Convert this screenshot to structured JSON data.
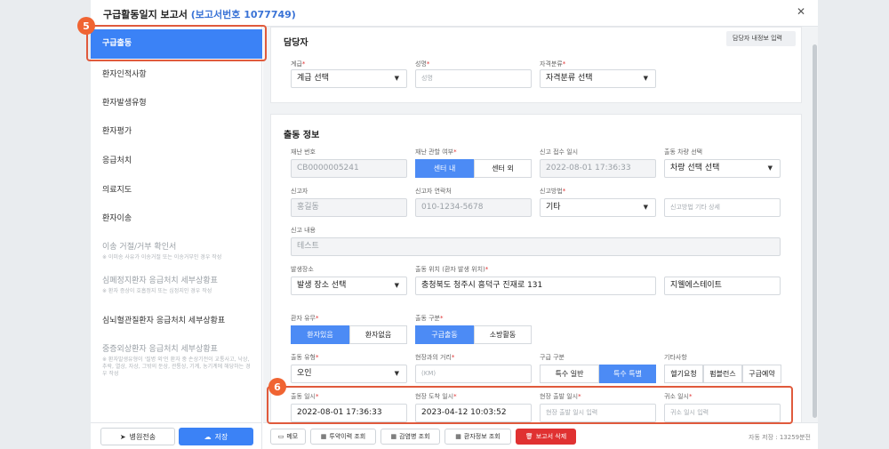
{
  "modal": {
    "title": "구급활동일지 보고서",
    "subtitle": "(보고서번호 1077749)"
  },
  "sidebar": {
    "items": [
      {
        "label": "구급출동"
      },
      {
        "label": "환자인적사항"
      },
      {
        "label": "환자발생유형"
      },
      {
        "label": "환자평가"
      },
      {
        "label": "응급처치"
      },
      {
        "label": "의료지도"
      },
      {
        "label": "환자이송"
      },
      {
        "label": "이송 거절/거부 확인서",
        "note": "※ 이미송 사유가 이송거절 또는 이송거부인 경우 작성"
      },
      {
        "label": "심폐정지환자 응급처치 세부상황표",
        "note": "※ 환자 증상이 호흡정지 또는 심정지인 경우 작성"
      },
      {
        "label": "심뇌혈관질환자 응급처치 세부상황표"
      },
      {
        "label": "중증외상환자 응급처치 세부상황표",
        "note": "※ 환자발생유형이 '질병 외'인 환자 중 손상기전이 교통사고, 낙상, 추락, 열상, 자상, 그밖의 둔상, 관통상, 기계, 농기계에 해당하는 경우 작성"
      }
    ],
    "footer": {
      "transfer": "병원전송",
      "save": "저장"
    }
  },
  "manager": {
    "title": "담당자",
    "self_button": "담당자 내정보 입력",
    "rank_label": "계급",
    "rank_value": "계급 선택",
    "name_label": "성명",
    "name_placeholder": "성명",
    "qual_label": "자격분류",
    "qual_value": "자격분류 선택"
  },
  "dispatch": {
    "title": "출동 정보",
    "disaster_no_label": "재난 번호",
    "disaster_no": "CB0000005241",
    "jurisdiction_label": "재난 관할 여부",
    "jur_in": "센터 내",
    "jur_out": "센터 외",
    "report_time_label": "신고 접수 일시",
    "report_time": "2022-08-01 17:36:33",
    "vehicle_label": "출동 차량 선택",
    "vehicle_value": "차량 선택 선택",
    "reporter_label": "신고자",
    "reporter": "홍길동",
    "contact_label": "신고자 연락처",
    "contact": "010-1234-5678",
    "method_label": "신고방법",
    "method_value": "기타",
    "method_detail_placeholder": "신고방법 기타 상세",
    "content_label": "신고 내용",
    "content": "테스트",
    "place_label": "발생장소",
    "place_value": "발생 장소 선택",
    "location_label": "출동 위치 (환자 발생 위치)",
    "location": "충청북도 청주시 흥덕구 진재로 131",
    "location2": "지웰에스테이트",
    "patient_label": "환자 유무",
    "patient_yes": "환자있음",
    "patient_no": "환자없음",
    "type_label": "출동 구분",
    "type_rescue": "구급출동",
    "type_fire": "소방활동",
    "dtype_label": "출동 유형",
    "dtype_value": "오인",
    "distance_label": "현장과의 거리",
    "distance_placeholder": "(KM)",
    "class_label": "구급 구분",
    "class_normal": "특수 일반",
    "class_special": "특수 특별",
    "etc_label": "기타사항",
    "etc1": "헬기요청",
    "etc2": "펌블런스",
    "etc3": "구급예약",
    "depart_label": "출동 일시",
    "depart": "2022-08-01 17:36:33",
    "arrive_label": "현장 도착 일시",
    "arrive": "2023-04-12 10:03:52",
    "leave_label": "현장 출발 일시",
    "leave_placeholder": "현장 출발 일시 입력",
    "return_label": "귀소 일시",
    "return_placeholder": "귀소 일시 입력"
  },
  "footer": {
    "memo": "메모",
    "drug": "투약이력 조회",
    "infect": "감염병 조회",
    "patient_info": "환자정보 조회",
    "delete": "보고서 삭제",
    "autosave": "자동 저장 : 13259분전"
  },
  "annotations": {
    "badge5": "5",
    "badge6": "6"
  },
  "colors": {
    "accent": "#3b82f6",
    "highlight": "#e05a3c",
    "delete": "#e03131"
  }
}
